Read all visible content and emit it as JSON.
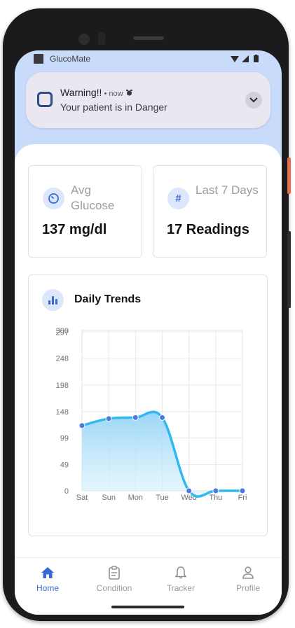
{
  "status_bar": {
    "app_name": "GlucoMate"
  },
  "notification": {
    "title": "Warning!!",
    "meta": " • now ",
    "body": "Your patient is in Danger"
  },
  "stats": [
    {
      "label": "Avg Glucose",
      "value": "137 mg/dl",
      "icon": "gauge-icon"
    },
    {
      "label": "Last 7 Days",
      "value": "17 Readings",
      "icon": "hash-icon"
    }
  ],
  "trends": {
    "title": "Daily Trends"
  },
  "chart_data": {
    "type": "line",
    "categories": [
      "Sat",
      "Sun",
      "Mon",
      "Tue",
      "Wed",
      "Thu",
      "Fri"
    ],
    "values": [
      122,
      135,
      137,
      137,
      0,
      0,
      0
    ],
    "yticks": [
      "0",
      "49",
      "99",
      "148",
      "198",
      "248",
      "297",
      "300"
    ],
    "ylim": [
      0,
      300
    ],
    "grid": true,
    "line_color": "#2fb9f0",
    "point_color": "#4a7be3"
  },
  "nav": {
    "items": [
      {
        "label": "Home",
        "icon": "home-icon",
        "active": true
      },
      {
        "label": "Condition",
        "icon": "clipboard-icon",
        "active": false
      },
      {
        "label": "Tracker",
        "icon": "bell-icon",
        "active": false
      },
      {
        "label": "Profile",
        "icon": "person-icon",
        "active": false
      }
    ]
  },
  "colors": {
    "accent": "#3569d6",
    "header_bg": "#c9dbfb",
    "notification_bg": "#ebe7f0"
  }
}
